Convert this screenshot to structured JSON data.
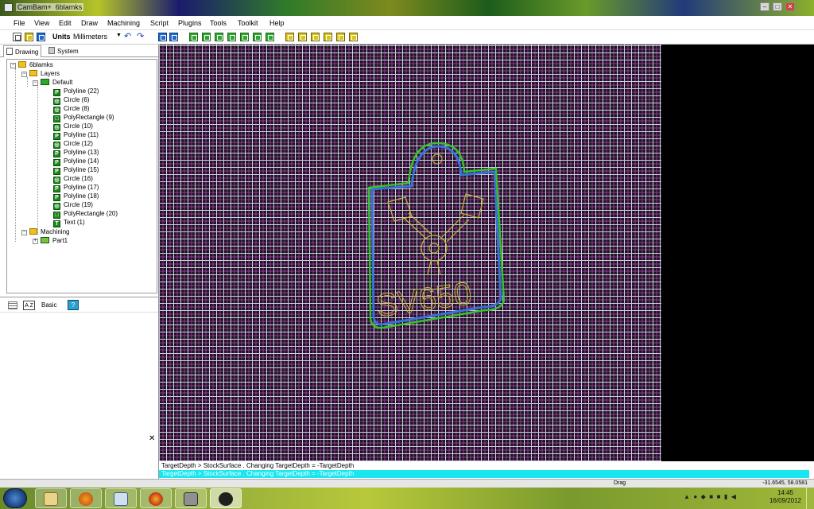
{
  "window": {
    "app_title": "CamBam+",
    "doc_title": "6blamks",
    "minimize_glyph": "–",
    "maximize_glyph": "□",
    "close_glyph": "✕"
  },
  "menu": [
    "File",
    "View",
    "Edit",
    "Draw",
    "Machining",
    "Script",
    "Plugins",
    "Tools",
    "Toolkit",
    "Help"
  ],
  "toolbar": {
    "units_label": "Units",
    "units_value": "Millimeters",
    "undo_icon": "undo-icon",
    "redo_icon": "redo-icon"
  },
  "left_tabs": {
    "drawing": "Drawing",
    "system": "System"
  },
  "tree": {
    "root": "6blamks",
    "layers": "Layers",
    "default_layer": "Default",
    "entities": [
      {
        "label": "Polyline (22)",
        "kind": "polyline"
      },
      {
        "label": "Circle (6)",
        "kind": "circle"
      },
      {
        "label": "Circle (8)",
        "kind": "circle"
      },
      {
        "label": "PolyRectangle (9)",
        "kind": "polyrect"
      },
      {
        "label": "Circle (10)",
        "kind": "circle"
      },
      {
        "label": "Polyline (11)",
        "kind": "polyline"
      },
      {
        "label": "Circle (12)",
        "kind": "circle"
      },
      {
        "label": "Polyline (13)",
        "kind": "polyline"
      },
      {
        "label": "Polyline (14)",
        "kind": "polyline"
      },
      {
        "label": "Polyline (15)",
        "kind": "polyline"
      },
      {
        "label": "Circle (16)",
        "kind": "circle"
      },
      {
        "label": "Polyline (17)",
        "kind": "polyline"
      },
      {
        "label": "Polyline (18)",
        "kind": "polyline"
      },
      {
        "label": "Circle (19)",
        "kind": "circle"
      },
      {
        "label": "PolyRectangle (20)",
        "kind": "polyrect"
      },
      {
        "label": "Text (1)",
        "kind": "text"
      }
    ],
    "machining": "Machining",
    "part": "Part1"
  },
  "property_bar": {
    "mode_label": "Basic",
    "sort_label": "A Z",
    "help_label": "?"
  },
  "panel_close": "✕",
  "canvas": {
    "drawing_text": "SV650"
  },
  "messages": {
    "line1": "TargetDepth > StockSurface . Changing TargetDepth = -TargetDepth",
    "line2": "TargetDepth > StockSurface . Changing TargetDepth = -TargetDepth"
  },
  "status": {
    "mode": "Drag",
    "coords": "-31.6545, 58.0581"
  },
  "taskbar": {
    "apps": [
      "explorer",
      "media-player",
      "media-center",
      "firefox",
      "remote-app",
      "cambam"
    ],
    "clock_time": "14:45",
    "clock_date": "16/09/2012"
  },
  "colors": {
    "grid_major": "#d8c8e8",
    "grid_minor": "#c83cc8",
    "outline_green": "#36c22c",
    "outline_blue": "#3a70d8",
    "engrave_yellow": "#c7b43a",
    "message_highlight": "#19e6ef"
  }
}
